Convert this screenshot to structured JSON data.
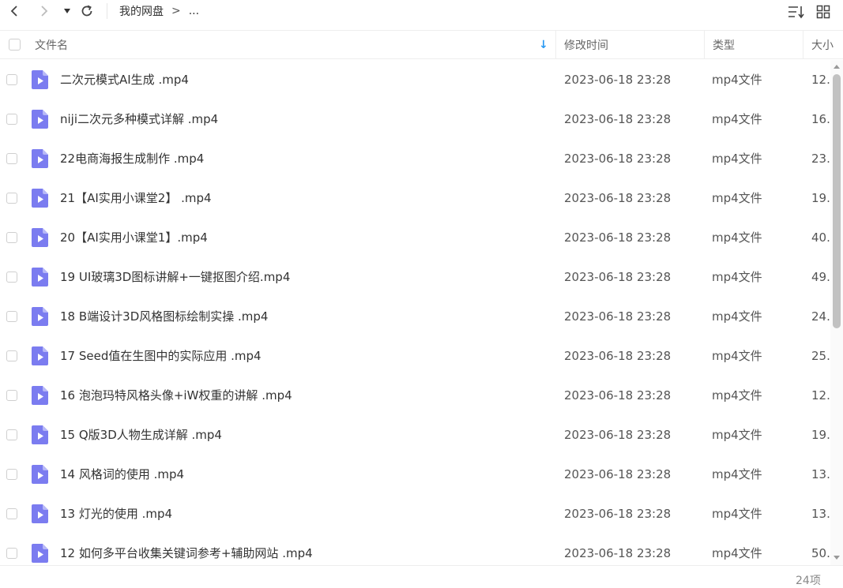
{
  "toolbar": {
    "back_icon": "chevron-left-icon",
    "forward_icon": "chevron-right-icon",
    "history_icon": "caret-down-icon",
    "refresh_icon": "refresh-icon",
    "sort_icon": "sort-list-icon",
    "view_icon": "grid-view-icon"
  },
  "breadcrumb": {
    "root": "我的网盘",
    "separator": ">",
    "ellipsis": "..."
  },
  "header": {
    "name": "文件名",
    "modified": "修改时间",
    "type": "类型",
    "size": "大小",
    "sort_indicator": "↓"
  },
  "files": [
    {
      "name": "二次元模式AI生成 .mp4",
      "modified": "2023-06-18 23:28",
      "type": "mp4文件",
      "size": "12."
    },
    {
      "name": "niji二次元多种模式详解 .mp4",
      "modified": "2023-06-18 23:28",
      "type": "mp4文件",
      "size": "16."
    },
    {
      "name": "22电商海报生成制作 .mp4",
      "modified": "2023-06-18 23:28",
      "type": "mp4文件",
      "size": "23."
    },
    {
      "name": "21【AI实用小课堂2】 .mp4",
      "modified": "2023-06-18 23:28",
      "type": "mp4文件",
      "size": "19."
    },
    {
      "name": "20【AI实用小课堂1】.mp4",
      "modified": "2023-06-18 23:28",
      "type": "mp4文件",
      "size": "40."
    },
    {
      "name": "19 UI玻璃3D图标讲解+一键抠图介绍.mp4",
      "modified": "2023-06-18 23:28",
      "type": "mp4文件",
      "size": "49."
    },
    {
      "name": "18 B端设计3D风格图标绘制实操 .mp4",
      "modified": "2023-06-18 23:28",
      "type": "mp4文件",
      "size": "24."
    },
    {
      "name": "17 Seed值在生图中的实际应用 .mp4",
      "modified": "2023-06-18 23:28",
      "type": "mp4文件",
      "size": "25."
    },
    {
      "name": "16 泡泡玛特风格头像+iW权重的讲解 .mp4",
      "modified": "2023-06-18 23:28",
      "type": "mp4文件",
      "size": "12."
    },
    {
      "name": "15 Q版3D人物生成详解 .mp4",
      "modified": "2023-06-18 23:28",
      "type": "mp4文件",
      "size": "19."
    },
    {
      "name": "14 风格词的使用 .mp4",
      "modified": "2023-06-18 23:28",
      "type": "mp4文件",
      "size": "13."
    },
    {
      "name": "13 灯光的使用 .mp4",
      "modified": "2023-06-18 23:28",
      "type": "mp4文件",
      "size": "13."
    },
    {
      "name": "12 如何多平台收集关键词参考+辅助网站 .mp4",
      "modified": "2023-06-18 23:28",
      "type": "mp4文件",
      "size": "50."
    }
  ],
  "footer": {
    "count": "24项"
  },
  "colors": {
    "accent": "#2b9af3",
    "file_icon": "#7b7cf0",
    "file_icon_fold": "#b7b8f7"
  }
}
